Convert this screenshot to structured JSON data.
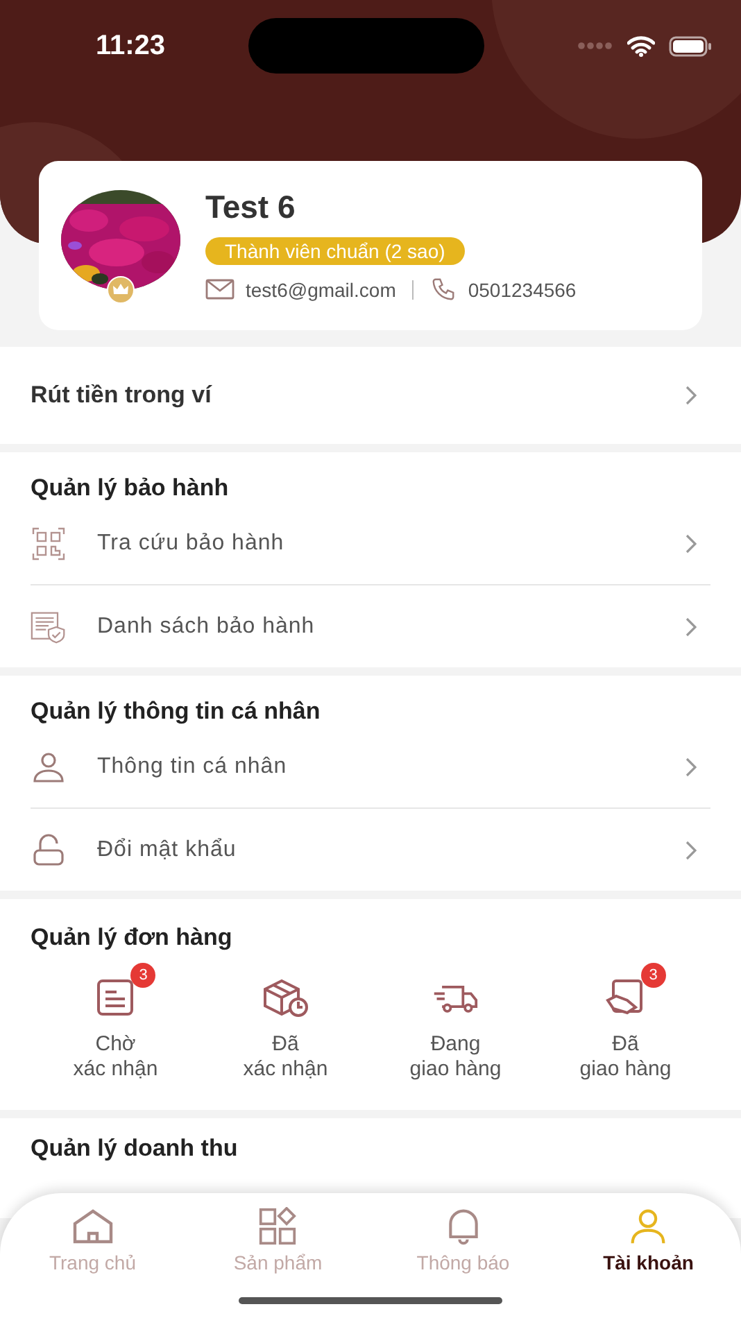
{
  "status_bar": {
    "time": "11:23"
  },
  "profile": {
    "name": "Test 6",
    "tier": "Thành viên chuẩn (2 sao)",
    "email": "test6@gmail.com",
    "phone": "0501234566"
  },
  "wallet": {
    "label": "Rút tiền trong ví"
  },
  "sections": [
    {
      "title": "Quản lý bảo hành",
      "items": [
        {
          "kind": "qr",
          "label": "Tra cứu bảo hành"
        },
        {
          "kind": "warranty",
          "label": "Danh sách bảo hành"
        }
      ]
    },
    {
      "title": "Quản lý thông tin cá nhân",
      "items": [
        {
          "kind": "person",
          "label": "Thông tin cá nhân"
        },
        {
          "kind": "lock",
          "label": "Đổi mật khẩu"
        }
      ]
    }
  ],
  "orders": {
    "title": "Quản lý đơn hàng",
    "items": [
      {
        "kind": "pending",
        "line1": "Chờ",
        "line2": "xác nhận",
        "badge": "3"
      },
      {
        "kind": "confirmed",
        "line1": "Đã",
        "line2": "xác nhận"
      },
      {
        "kind": "shipping",
        "line1": "Đang",
        "line2": "giao hàng"
      },
      {
        "kind": "delivered",
        "line1": "Đã",
        "line2": "giao hàng",
        "badge": "3"
      }
    ]
  },
  "revenue": {
    "title": "Quản lý doanh thu"
  },
  "tab_bar": [
    {
      "kind": "home",
      "label": "Trang chủ",
      "selected": false
    },
    {
      "kind": "products",
      "label": "Sản phẩm",
      "selected": false
    },
    {
      "kind": "bell",
      "label": "Thông báo",
      "selected": false
    },
    {
      "kind": "account",
      "label": "Tài khoản",
      "selected": true
    }
  ]
}
